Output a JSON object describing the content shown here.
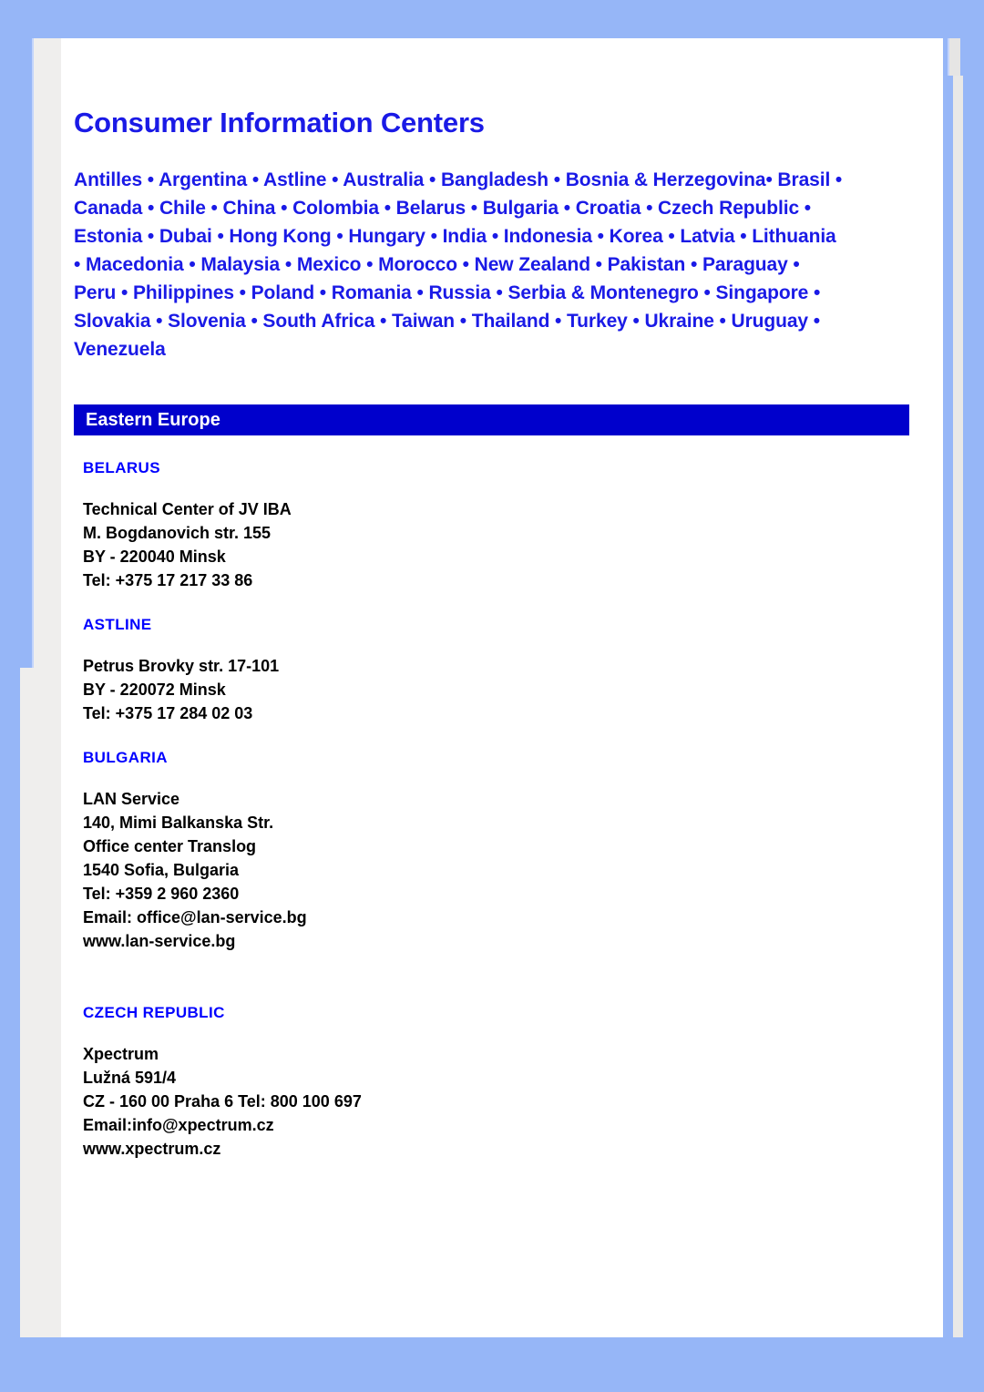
{
  "document": {
    "title": "Consumer Information Centers",
    "countries_lines": [
      "Antilles • Argentina • Astline • Australia • Bangladesh • Bosnia & Herzegovina• Brasil •",
      "Canada • Chile • China • Colombia • Belarus • Bulgaria • Croatia • Czech Republic •",
      "Estonia • Dubai •  Hong Kong • Hungary • India • Indonesia • Korea • Latvia • Lithuania",
      "• Macedonia • Malaysia • Mexico • Morocco • New Zealand • Pakistan • Paraguay •",
      "Peru • Philippines • Poland • Romania • Russia • Serbia & Montenegro • Singapore •",
      "Slovakia • Slovenia • South Africa • Taiwan • Thailand • Turkey • Ukraine • Uruguay •",
      "Venezuela"
    ],
    "region_bar": "Eastern Europe",
    "entries": [
      {
        "heading": "BELARUS",
        "lines": [
          "Technical Center of JV IBA",
          "M. Bogdanovich str. 155",
          "BY - 220040 Minsk",
          "Tel: +375 17 217 33 86"
        ]
      },
      {
        "heading": "ASTLINE",
        "lines": [
          "Petrus Brovky str. 17-101",
          "BY - 220072 Minsk",
          "Tel: +375 17 284 02 03"
        ]
      },
      {
        "heading": "BULGARIA",
        "lines": [
          "LAN Service",
          "140, Mimi Balkanska Str.",
          "Office center Translog",
          "1540 Sofia, Bulgaria",
          "Tel: +359 2 960 2360",
          "Email: office@lan-service.bg",
          "www.lan-service.bg"
        ]
      },
      {
        "heading": "CZECH REPUBLIC",
        "lines": [
          "Xpectrum",
          "Lužná 591/4",
          "CZ - 160 00 Praha 6 Tel: 800 100 697",
          "Email:info@xpectrum.cz",
          "www.xpectrum.cz"
        ]
      }
    ]
  },
  "colors": {
    "page_background": "#96b6f7",
    "paper": "#ffffff",
    "gutter": "#efeeed",
    "title_blue": "#1a1ae6",
    "heading_blue": "#0000ff",
    "region_bar_blue": "#0000cc",
    "body_text": "#000000"
  }
}
